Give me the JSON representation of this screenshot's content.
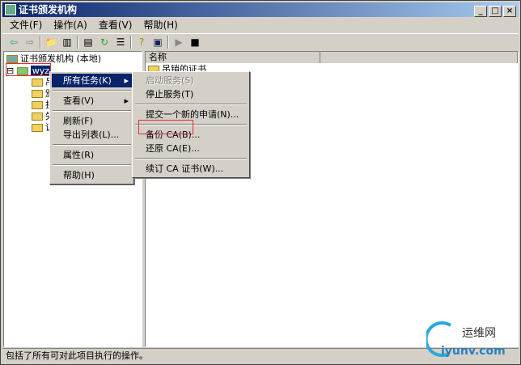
{
  "window": {
    "title": "证书颁发机构",
    "controls": [
      "_",
      "□",
      "×"
    ]
  },
  "menubar": [
    "文件(F)",
    "操作(A)",
    "查看(V)",
    "帮助(H)"
  ],
  "tree": {
    "root": "证书颁发机构 (本地)",
    "ca": "wyz",
    "children": [
      "吊",
      "颁",
      "挂",
      "失",
      "证"
    ]
  },
  "list": {
    "column": "名称",
    "items": [
      "吊销的证书"
    ]
  },
  "context_menu": [
    "所有任务(K)",
    "查看(V)",
    "刷新(F)",
    "导出列表(L)...",
    "属性(R)",
    "帮助(H)"
  ],
  "submenu": [
    "启动服务(S)",
    "停止服务(T)",
    "提交一个新的申请(N)...",
    "备份 CA(B)...",
    "还原 CA(E)...",
    "续订 CA 证书(W)..."
  ],
  "status": "包括了所有可对此项目执行的操作。",
  "watermark": {
    "name": "运维网",
    "url": "iyunv.com"
  }
}
